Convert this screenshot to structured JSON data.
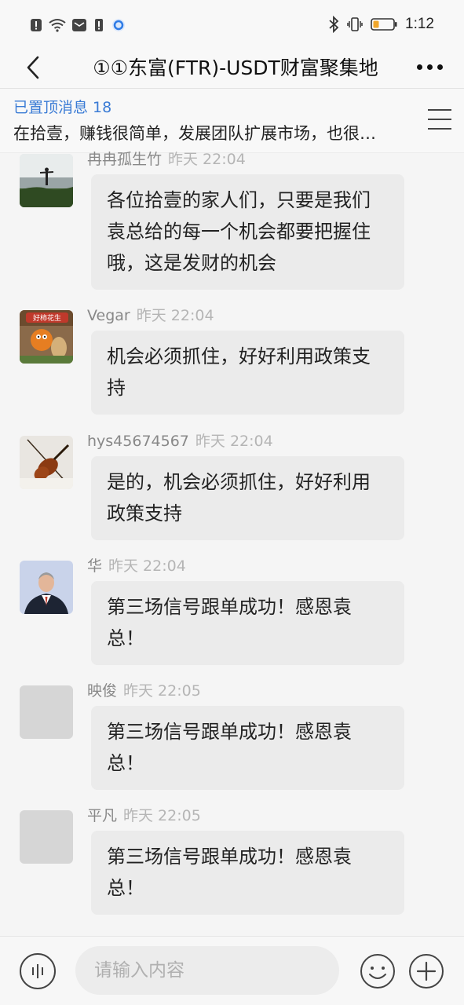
{
  "status_bar": {
    "time": "1:12",
    "icons": [
      "alert-icon",
      "wifi-icon",
      "mail-icon",
      "alert-icon",
      "app-icon",
      "bluetooth-icon",
      "vibrate-icon",
      "battery-icon"
    ]
  },
  "header": {
    "title": "①①东富(FTR)-USDT财富聚集地",
    "back_icon": "back-arrow-icon",
    "more_icon": "more-icon"
  },
  "pinned": {
    "title": "已置顶消息 18",
    "text": "在拾壹，赚钱很简单，发展团队扩展市场，也很…"
  },
  "messages": [
    {
      "sender": "冉冉孤生竹",
      "time": "昨天 22:04",
      "text": "各位拾壹的家人们，只要是我们袁总给的每一个机会都要把握住哦，这是发财的机会"
    },
    {
      "sender": "Vegar",
      "time": "昨天 22:04",
      "text": "机会必须抓住，好好利用政策支持",
      "avatar_text": "好柿花生"
    },
    {
      "sender": "hys45674567",
      "time": "昨天 22:04",
      "text": "是的，机会必须抓住，好好利用政策支持"
    },
    {
      "sender": "华",
      "time": "昨天 22:04",
      "text": "第三场信号跟单成功！感恩袁总！"
    },
    {
      "sender": "映俊",
      "time": "昨天 22:05",
      "text": "第三场信号跟单成功！感恩袁总！"
    },
    {
      "sender": "平凡",
      "time": "昨天 22:05",
      "text": "第三场信号跟单成功！感恩袁总！"
    }
  ],
  "input_bar": {
    "placeholder": "请输入内容",
    "value": ""
  },
  "colors": {
    "accent": "#3a7bd5",
    "bubble": "#ebebeb",
    "background": "#f5f5f5"
  }
}
